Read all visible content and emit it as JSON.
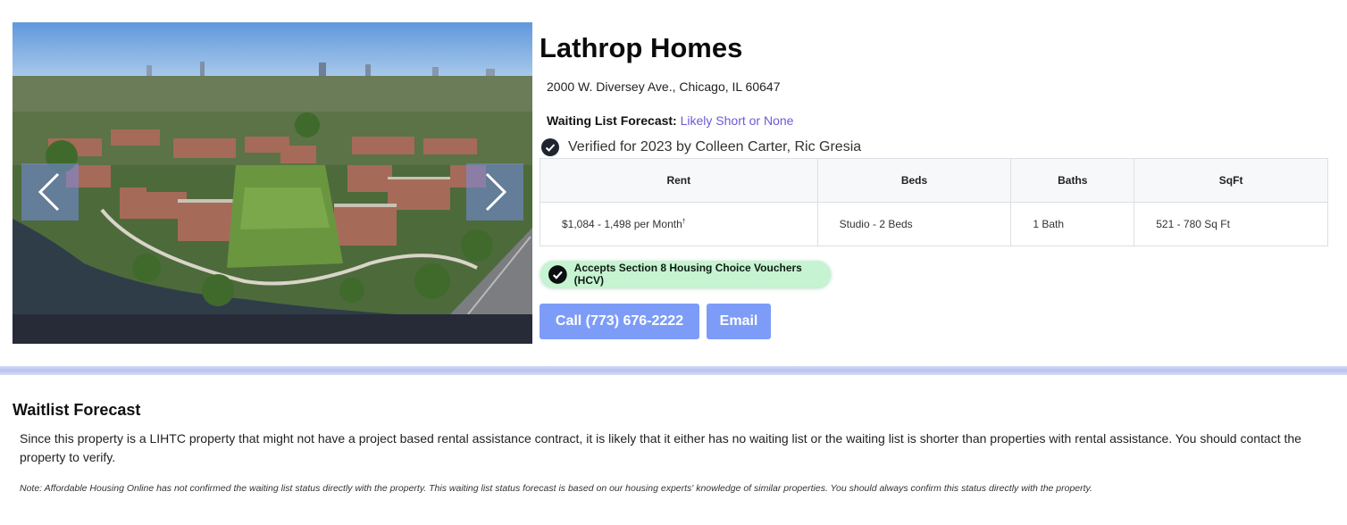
{
  "property": {
    "name": "Lathrop Homes",
    "address": "2000 W. Diversey Ave., Chicago, IL 60647",
    "forecast_label": "Waiting List Forecast:",
    "forecast_value": "Likely Short or None",
    "verified_text": "Verified for 2023 by Colleen Carter, Ric Gresia"
  },
  "carousel": {
    "prev_icon": "chevron-left-icon",
    "next_icon": "chevron-right-icon"
  },
  "table": {
    "headers": [
      "Rent",
      "Beds",
      "Baths",
      "SqFt"
    ],
    "row": {
      "rent": "$1,084 - 1,498 per Month",
      "rent_mark": "†",
      "beds": "Studio - 2 Beds",
      "baths": "1 Bath",
      "sqft": "521 - 780 Sq Ft"
    }
  },
  "badge": {
    "label": "Accepts Section 8 Housing Choice Vouchers (HCV)"
  },
  "actions": {
    "call_label": "Call (773) 676-2222",
    "email_label": "Email"
  },
  "waitlist": {
    "title": "Waitlist Forecast",
    "body": "Since this property is a LIHTC property that might not have a project based rental assistance contract, it is likely that it either has no waiting list or the waiting list is shorter than properties with rental assistance. You should contact the property to verify.",
    "note": "Note: Affordable Housing Online has not confirmed the waiting list status directly with the property. This waiting list status forecast is based on our housing experts' knowledge of similar properties. You should always confirm this status directly with the property."
  },
  "colors": {
    "link": "#6a5bd6",
    "button": "#7d9cf7",
    "badge_bg": "#c6f3d1",
    "divider": "#b9c2ef"
  }
}
